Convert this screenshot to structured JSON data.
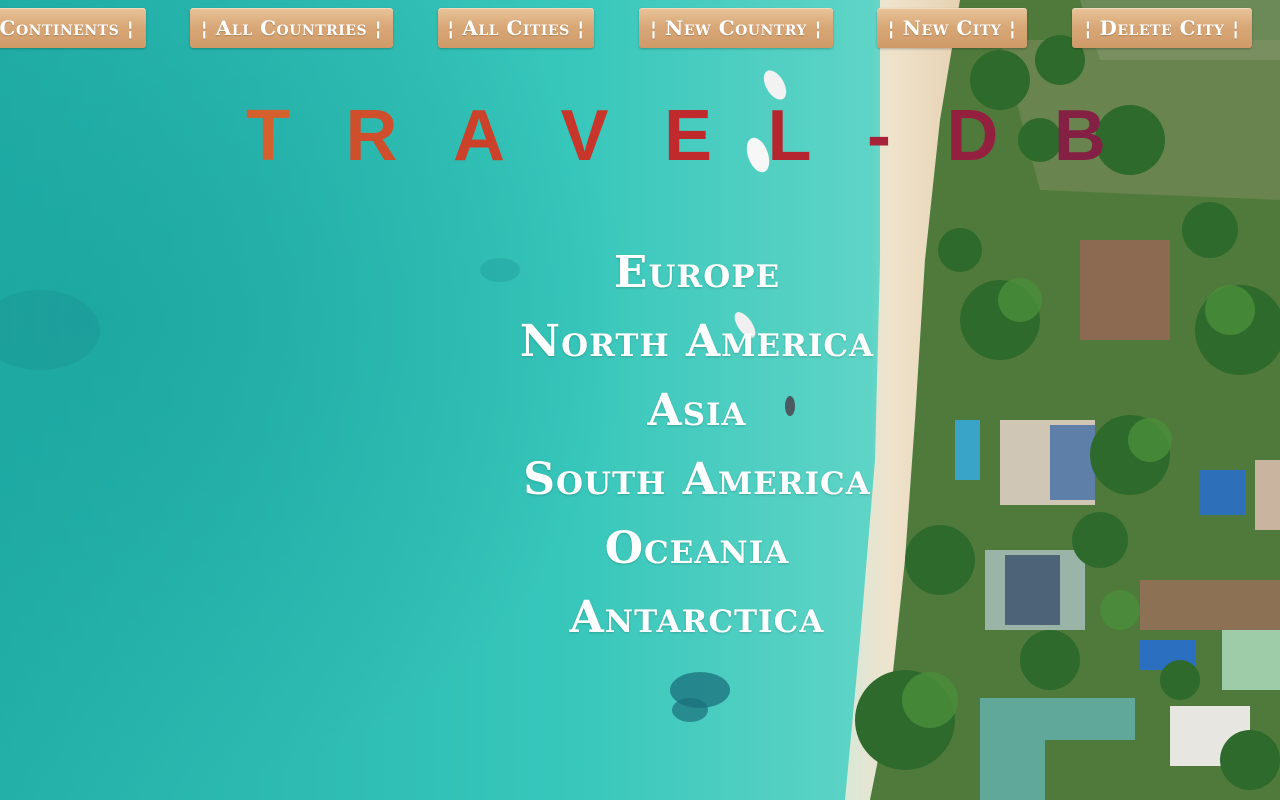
{
  "nav": {
    "buttons": [
      {
        "label": "Continents ¦"
      },
      {
        "label": "¦ All Countries ¦"
      },
      {
        "label": "¦ All Cities ¦"
      },
      {
        "label": "¦ New Country ¦"
      },
      {
        "label": "¦ New City ¦"
      },
      {
        "label": "¦ Delete City ¦"
      }
    ]
  },
  "title": {
    "letters": [
      "T",
      "R",
      "A",
      "V",
      "E",
      "L",
      "-",
      "D",
      "B"
    ],
    "colors": [
      "#d4602e",
      "#cf4f2c",
      "#cc412a",
      "#c8352a",
      "#c02a2c",
      "#b52530",
      "#a8223a",
      "#942040",
      "#842044"
    ]
  },
  "continents": [
    "Europe",
    "North America",
    "Asia",
    "South America",
    "Oceania",
    "Antarctica"
  ]
}
